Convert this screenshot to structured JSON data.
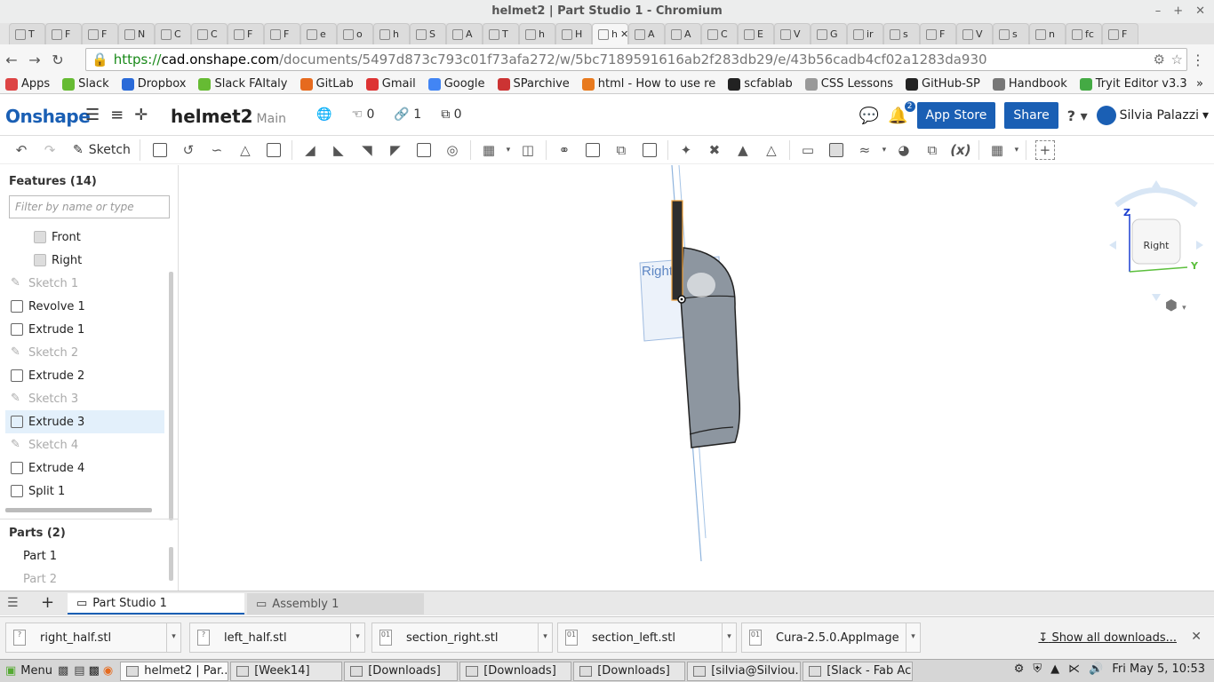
{
  "window": {
    "title": "helmet2 | Part Studio 1 - Chromium",
    "controls": [
      "–",
      "+",
      "✕"
    ]
  },
  "browser_tabs": [
    {
      "label": "T"
    },
    {
      "label": "F"
    },
    {
      "label": "F"
    },
    {
      "label": "N"
    },
    {
      "label": "C"
    },
    {
      "label": "C"
    },
    {
      "label": "F"
    },
    {
      "label": "F"
    },
    {
      "label": "e"
    },
    {
      "label": "o"
    },
    {
      "label": "h"
    },
    {
      "label": "S"
    },
    {
      "label": "A"
    },
    {
      "label": "T"
    },
    {
      "label": "h"
    },
    {
      "label": "H"
    },
    {
      "label": "h",
      "active": true
    },
    {
      "label": "A"
    },
    {
      "label": "A"
    },
    {
      "label": "C"
    },
    {
      "label": "E"
    },
    {
      "label": "V"
    },
    {
      "label": "G"
    },
    {
      "label": "ir"
    },
    {
      "label": "s"
    },
    {
      "label": "F"
    },
    {
      "label": "V"
    },
    {
      "label": "s"
    },
    {
      "label": "n"
    },
    {
      "label": "fc"
    },
    {
      "label": "F"
    }
  ],
  "address": {
    "scheme": "https://",
    "host": "cad.onshape.com",
    "path": "/documents/5497d873c793c01f73afa272/w/5bc7189591616ab2f283db29/e/43b56cadb4cf02a1283da930"
  },
  "bookmarks": [
    {
      "label": "Apps",
      "color": "#d44"
    },
    {
      "label": "Slack",
      "color": "#6b3"
    },
    {
      "label": "Dropbox",
      "color": "#2a6ad8"
    },
    {
      "label": "Slack FAItaly",
      "color": "#6b3"
    },
    {
      "label": "GitLab",
      "color": "#e66a1e"
    },
    {
      "label": "Gmail",
      "color": "#d33"
    },
    {
      "label": "Google",
      "color": "#4285f4"
    },
    {
      "label": "SParchive",
      "color": "#c33"
    },
    {
      "label": "html - How to use re",
      "color": "#e87a1e"
    },
    {
      "label": "scfablab",
      "color": "#222"
    },
    {
      "label": "CSS Lessons",
      "color": "#999"
    },
    {
      "label": "GitHub-SP",
      "color": "#222"
    },
    {
      "label": "Handbook",
      "color": "#777"
    },
    {
      "label": "Tryit Editor v3.3",
      "color": "#4a4"
    }
  ],
  "onshape": {
    "logo": "Onshape",
    "doc_name": "helmet2",
    "branch": "Main",
    "likes": "0",
    "links": "1",
    "copies": "0",
    "notifications": "2",
    "app_store": "App Store",
    "share": "Share",
    "help": "?",
    "user": "Silvia Palazzi"
  },
  "toolbar": {
    "sketch_label": "Sketch"
  },
  "features": {
    "heading": "Features (14)",
    "filter_placeholder": "Filter by name or type",
    "items": [
      {
        "label": "Front",
        "kind": "plane"
      },
      {
        "label": "Right",
        "kind": "plane"
      },
      {
        "label": "Sketch 1",
        "kind": "sketch"
      },
      {
        "label": "Revolve 1",
        "kind": "feature"
      },
      {
        "label": "Extrude 1",
        "kind": "feature"
      },
      {
        "label": "Sketch 2",
        "kind": "sketch"
      },
      {
        "label": "Extrude 2",
        "kind": "feature"
      },
      {
        "label": "Sketch 3",
        "kind": "sketch"
      },
      {
        "label": "Extrude 3",
        "kind": "feature",
        "selected": true
      },
      {
        "label": "Sketch 4",
        "kind": "sketch"
      },
      {
        "label": "Extrude 4",
        "kind": "feature"
      },
      {
        "label": "Split 1",
        "kind": "feature"
      }
    ]
  },
  "parts": {
    "heading": "Parts (2)",
    "items": [
      "Part 1",
      "Part 2"
    ]
  },
  "viewport": {
    "plane_label": "Right",
    "view_cube_label": "Right",
    "axis_z": "Z",
    "axis_y": "Y"
  },
  "bottom_tabs": {
    "part_studio": "Part Studio 1",
    "assembly": "Assembly 1"
  },
  "downloads": {
    "items": [
      "right_half.stl",
      "left_half.stl",
      "section_right.stl",
      "section_left.stl",
      "Cura-2.5.0.AppImage"
    ],
    "show_all": "Show all downloads...",
    "close": "✕"
  },
  "taskbar": {
    "menu": "Menu",
    "windows": [
      {
        "label": "helmet2 | Par...",
        "active": true
      },
      {
        "label": "[Week14]"
      },
      {
        "label": "[Downloads]"
      },
      {
        "label": "[Downloads]"
      },
      {
        "label": "[Downloads]"
      },
      {
        "label": "[silvia@Silviou..."
      },
      {
        "label": "[Slack - Fab Ac..."
      }
    ],
    "clock": "Fri May  5, 10:53"
  }
}
